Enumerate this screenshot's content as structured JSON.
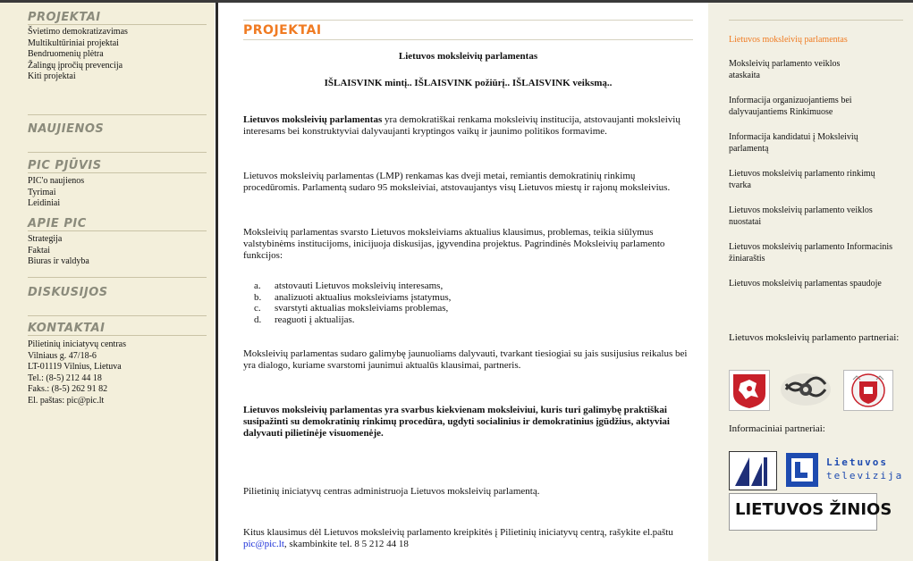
{
  "left_nav": {
    "projektai_title": "PROJEKTAI",
    "projektai_items": [
      "Švietimo demokratizavimas",
      "Multikultūriniai projektai",
      "Bendruomenių plėtra",
      "Žalingų įpročių prevencija",
      "Kiti projektai"
    ],
    "naujienos_title": "NAUJIENOS",
    "pic_pjuvis_title": "PIC PJŪVIS",
    "pic_pjuvis_items": [
      "PIC'o naujienos",
      "Tyrimai",
      "Leidiniai"
    ],
    "apie_title": "APIE PIC",
    "apie_items": [
      "Strategija",
      "Faktai",
      "Biuras ir valdyba"
    ],
    "diskusijos_title": "DISKUSIJOS",
    "kontaktai_title": "KONTAKTAI",
    "kontaktai_lines": [
      "Pilietinių iniciatyvų centras",
      "Vilniaus g. 47/18-6",
      "LT-01119 Vilnius, Lietuva",
      "Tel.: (8-5) 212 44 18",
      "Faks.: (8-5) 262 91 82",
      "El. paštas: pic@pic.lt"
    ]
  },
  "main": {
    "section_title": "PROJEKTAI",
    "heading": "Lietuvos moksleivių parlamentas",
    "slogan": "IŠLAISVINK mintį.. IŠLAISVINK požiūrį.. IŠLAISVINK veiksmą..",
    "p1_bold": "Lietuvos moksleivių parlamentas",
    "p1_rest": " yra demokratiškai renkama moksleivių institucija, atstovaujanti moksleivių interesams bei konstruktyviai dalyvaujanti kryptingos vaikų ir jaunimo politikos formavime.",
    "p2": "Lietuvos moksleivių parlamentas (LMP) renkamas kas dveji metai, remiantis demokratinių rinkimų procedūromis. Parlamentą sudaro 95 moksleiviai, atstovaujantys visų Lietuvos miestų ir rajonų moksleivius.",
    "p3": "Moksleivių parlamentas svarsto Lietuvos moksleiviams aktualius klausimus, problemas, teikia siūlymus valstybinėms institucijoms, inicijuoja diskusijas, įgyvendina projektus. Pagrindinės Moksleivių parlamento funkcijos:",
    "functions": [
      {
        "letter": "a.",
        "text": "atstovauti Lietuvos moksleivių interesams,"
      },
      {
        "letter": "b.",
        "text": "analizuoti aktualius moksleiviams įstatymus,"
      },
      {
        "letter": "c.",
        "text": "svarstyti aktualias moksleiviams problemas,"
      },
      {
        "letter": "d.",
        "text": "reaguoti į aktualijas."
      }
    ],
    "p4": "Moksleivių parlamentas sudaro galimybę jaunuoliams dalyvauti, tvarkant tiesiogiai su jais susijusius reikalus bei yra dialogo, kuriame svarstomi jaunimui aktualūs klausimai, partneris.",
    "p5": "Lietuvos moksleivių parlamentas yra svarbus kiekvienam moksleiviui, kuris turi galimybę praktiškai susipažinti su demokratinių rinkimų procedūra, ugdyti socialinius ir demokratinius įgūdžius, aktyviai dalyvauti pilietinėje visuomenėje.",
    "p6": "Pilietinių iniciatyvų centras administruoja Lietuvos moksleivių parlamentą.",
    "p7_before": "Kitus klausimus dėl Lietuvos moksleivių parlamento kreipkitės į Pilietinių iniciatyvų centrą, rašykite el.paštu ",
    "p7_link": "pic@pic.lt",
    "p7_after": ", skambinkite tel. 8 5 212 44 18"
  },
  "right": {
    "links": [
      "Lietuvos moksleivių parlamentas",
      "Moksleivių parlamento veiklos ataskaita",
      "Informacija organizuojantiems bei dalyvaujantiems Rinkimuose",
      "Informacija kandidatui į Moksleivių parlamentą",
      "Lietuvos moksleivių parlamento rinkimų tvarka",
      "Lietuvos moksleivių parlamento veiklos nuostatai",
      "Lietuvos moksleivių parlamento Informacinis žiniaraštis",
      "Lietuvos moksleivių parlamentas spaudoje"
    ],
    "partners_label": "Lietuvos moksleivių parlamento partneriai:",
    "info_partners_label": "Informaciniai partneriai:",
    "ltv_logo_text1": "Lietuvos",
    "ltv_logo_text2": "televizija",
    "zinios_logo_text": "LIETUVOS ŽINIOS",
    "colors": {
      "accent": "#f07b22",
      "link": "#1a2ed8",
      "left_bg": "#f3efdb",
      "right_bg": "#f2f0e4"
    }
  }
}
